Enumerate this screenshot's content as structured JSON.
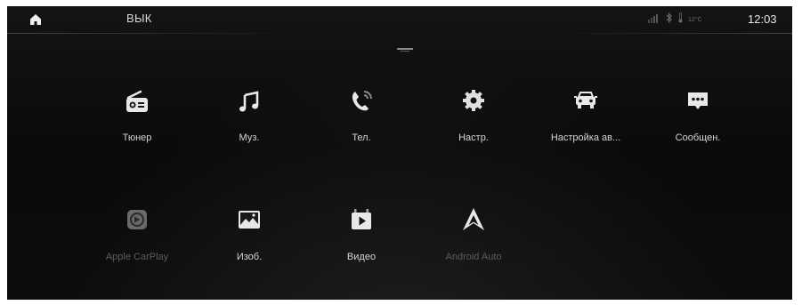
{
  "statusbar": {
    "mode": "ВЫК",
    "time": "12:03",
    "temperature": "12°C"
  },
  "apps": [
    {
      "label": "Тюнер",
      "icon": "radio-icon",
      "enabled": true
    },
    {
      "label": "Муз.",
      "icon": "music-note-icon",
      "enabled": true
    },
    {
      "label": "Тел.",
      "icon": "phone-icon",
      "enabled": true
    },
    {
      "label": "Настр.",
      "icon": "gear-icon",
      "enabled": true
    },
    {
      "label": "Настройка ав...",
      "icon": "car-icon",
      "enabled": true
    },
    {
      "label": "Сообщен.",
      "icon": "message-icon",
      "enabled": true
    },
    {
      "label": "Apple CarPlay",
      "icon": "carplay-icon",
      "enabled": false
    },
    {
      "label": "Изоб.",
      "icon": "image-icon",
      "enabled": true
    },
    {
      "label": "Видео",
      "icon": "video-icon",
      "enabled": true
    },
    {
      "label": "Android Auto",
      "icon": "android-auto-icon",
      "enabled": false
    }
  ]
}
